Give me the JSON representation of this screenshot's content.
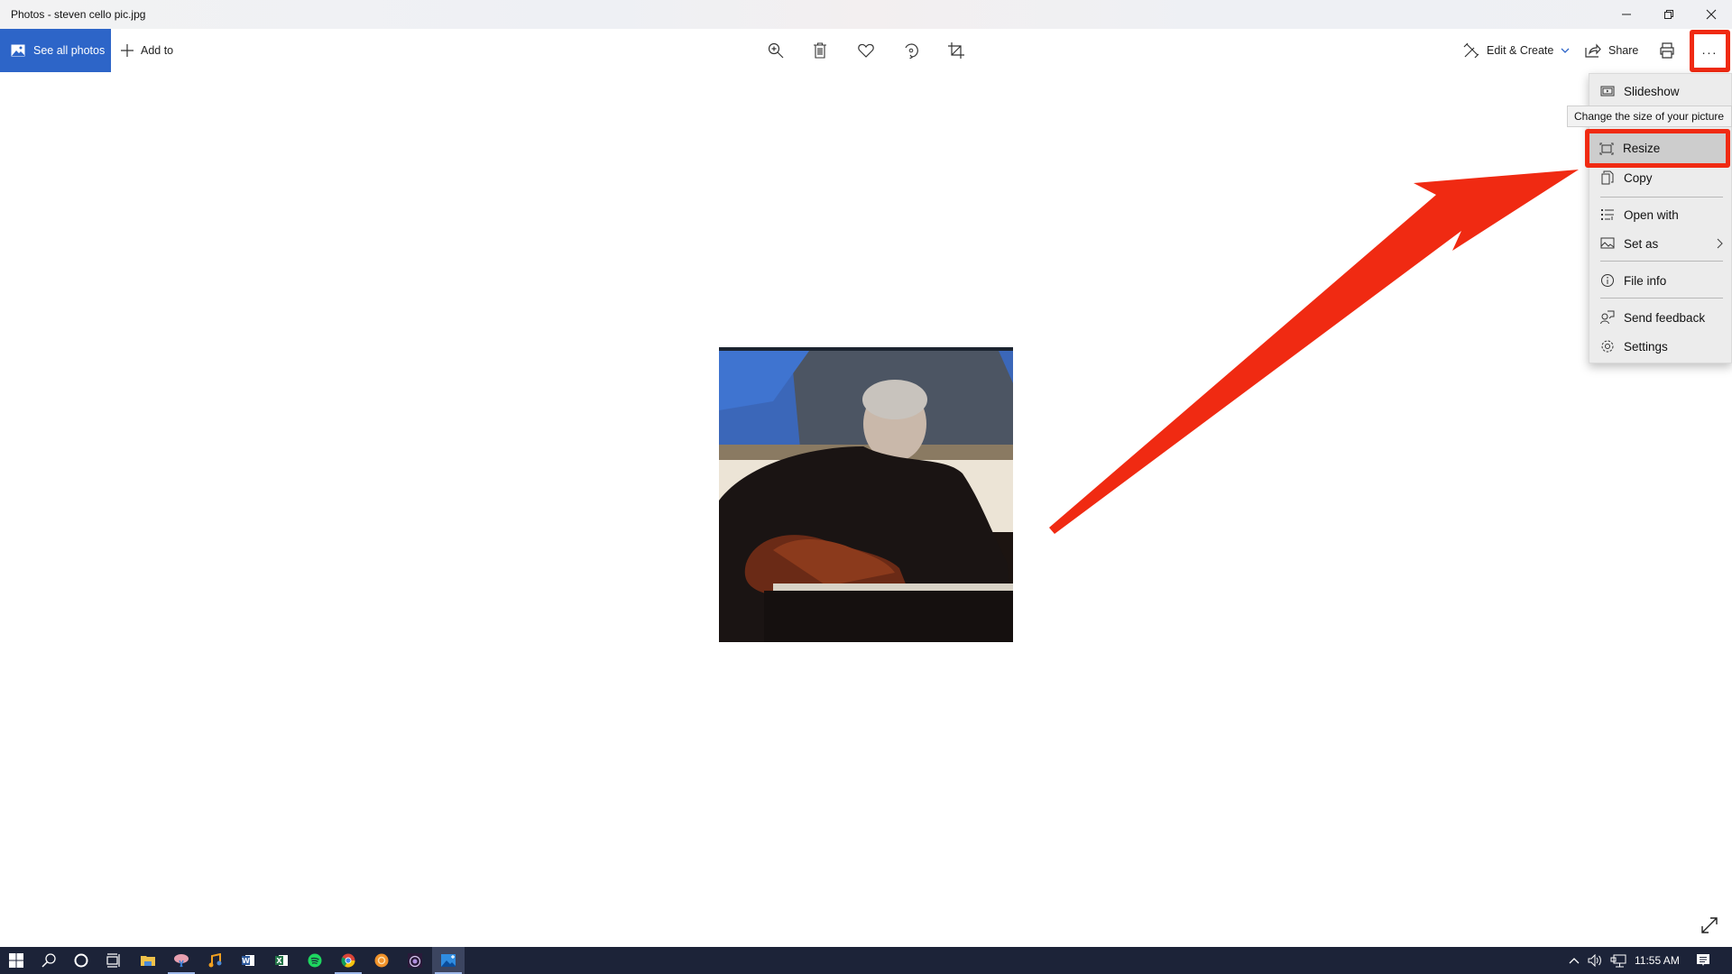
{
  "window": {
    "title": "Photos - steven cello pic.jpg",
    "controls": [
      "minimize",
      "restore",
      "close"
    ]
  },
  "toolbar": {
    "see_all_photos": "See all photos",
    "add_to": "Add to",
    "center_tools": [
      {
        "name": "zoom-in-icon",
        "label": "Zoom"
      },
      {
        "name": "delete-icon",
        "label": "Delete"
      },
      {
        "name": "heart-icon",
        "label": "Add to favorites"
      },
      {
        "name": "rotate-icon",
        "label": "Rotate"
      },
      {
        "name": "crop-icon",
        "label": "Crop"
      }
    ],
    "edit_create": "Edit & Create",
    "share": "Share",
    "print": "Print",
    "more": "..."
  },
  "menu": {
    "items": [
      {
        "label": "Slideshow",
        "icon": "slideshow-icon"
      },
      {
        "label": "Resize",
        "icon": "resize-icon",
        "highlighted": true
      },
      {
        "label": "Copy",
        "icon": "copy-icon"
      },
      {
        "label": "Open with",
        "icon": "open-with-icon"
      },
      {
        "label": "Set as",
        "icon": "set-as-icon",
        "submenu": true
      },
      {
        "label": "File info",
        "icon": "info-icon"
      },
      {
        "label": "Send feedback",
        "icon": "feedback-icon"
      },
      {
        "label": "Settings",
        "icon": "gear-icon"
      }
    ],
    "tooltip": "Change the size of your picture"
  },
  "photo": {
    "description": "Man in black shirt playing an archtop guitar in front of a blue abstract painting"
  },
  "annotation": {
    "arrow_color": "#f02a12",
    "highlight_color": "#f02a12"
  },
  "taskbar": {
    "apps": [
      "Start",
      "Search",
      "Cortana",
      "Task View",
      "File Explorer",
      "Snipping Tool",
      "Music",
      "Word",
      "Excel",
      "Spotify",
      "Chrome",
      "App",
      "Tor",
      "Photos"
    ],
    "time": "11:55 AM"
  },
  "colors": {
    "accent": "#2d65c8",
    "taskbar": "#1c2338",
    "menu_bg": "#ececec"
  }
}
